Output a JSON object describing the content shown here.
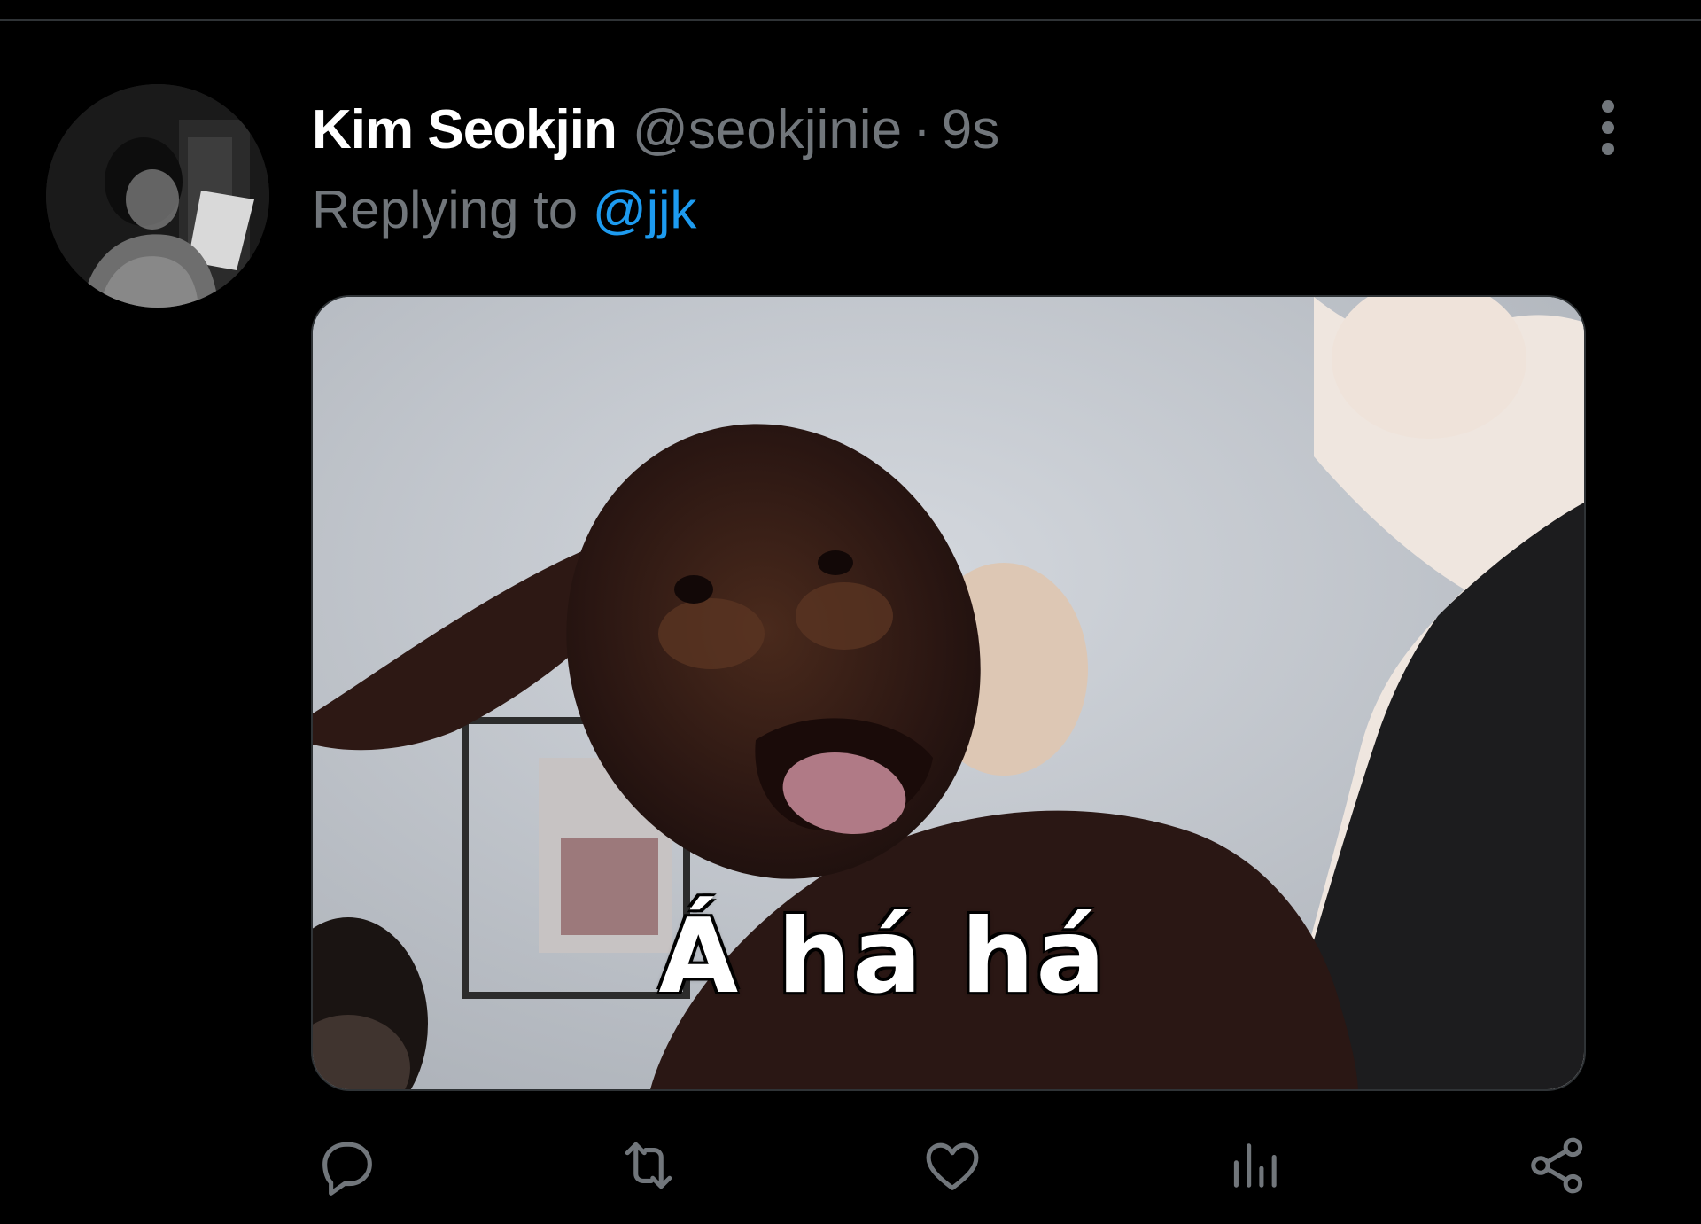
{
  "tweet": {
    "display_name": "Kim Seokjin",
    "handle": "@seokjinie",
    "separator": "·",
    "time": "9s",
    "reply_prefix": "Replying to",
    "reply_handle": "@jjk"
  },
  "media": {
    "caption": "Á há há"
  },
  "icons": {
    "more": "more-vertical-icon",
    "reply": "reply-icon",
    "retweet": "retweet-icon",
    "like": "heart-icon",
    "views": "analytics-icon",
    "share": "share-icon"
  },
  "colors": {
    "background": "#000000",
    "text_primary": "#ffffff",
    "text_secondary": "#71767b",
    "link": "#1d9bf0",
    "divider": "#2f3336"
  }
}
